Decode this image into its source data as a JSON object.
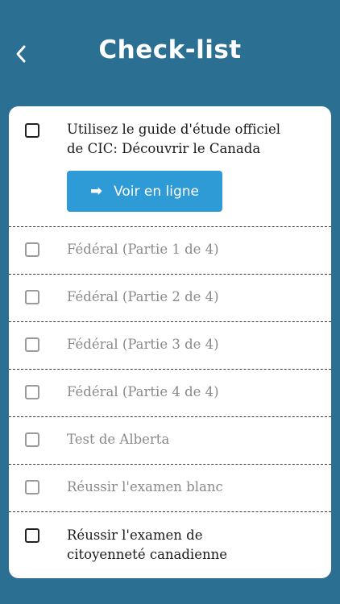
{
  "header": {
    "title": "Check-list",
    "back_icon": "chevron-left-icon"
  },
  "colors": {
    "background": "#2b6f93",
    "card": "#ffffff",
    "button": "#2e9bd6",
    "text": "#1a1a1a",
    "muted_text": "#8a8a8a"
  },
  "checklist": {
    "guide": {
      "line1": "Utilisez le guide d'étude officiel",
      "line2": "de CIC: Découvrir le Canada",
      "checked": false,
      "button_label": "Voir en ligne",
      "button_icon": "arrow-right-icon"
    },
    "items": [
      {
        "label": "Fédéral (Partie 1 de 4)",
        "checked": false
      },
      {
        "label": "Fédéral (Partie 2 de 4)",
        "checked": false
      },
      {
        "label": "Fédéral (Partie 3 de 4)",
        "checked": false
      },
      {
        "label": "Fédéral (Partie 4 de 4)",
        "checked": false
      },
      {
        "label": "Test de Alberta",
        "checked": false
      },
      {
        "label": "Réussir l'examen blanc",
        "checked": false
      }
    ],
    "final": {
      "line1": "Réussir l'examen de",
      "line2": "citoyenneté canadienne",
      "checked": false
    }
  }
}
